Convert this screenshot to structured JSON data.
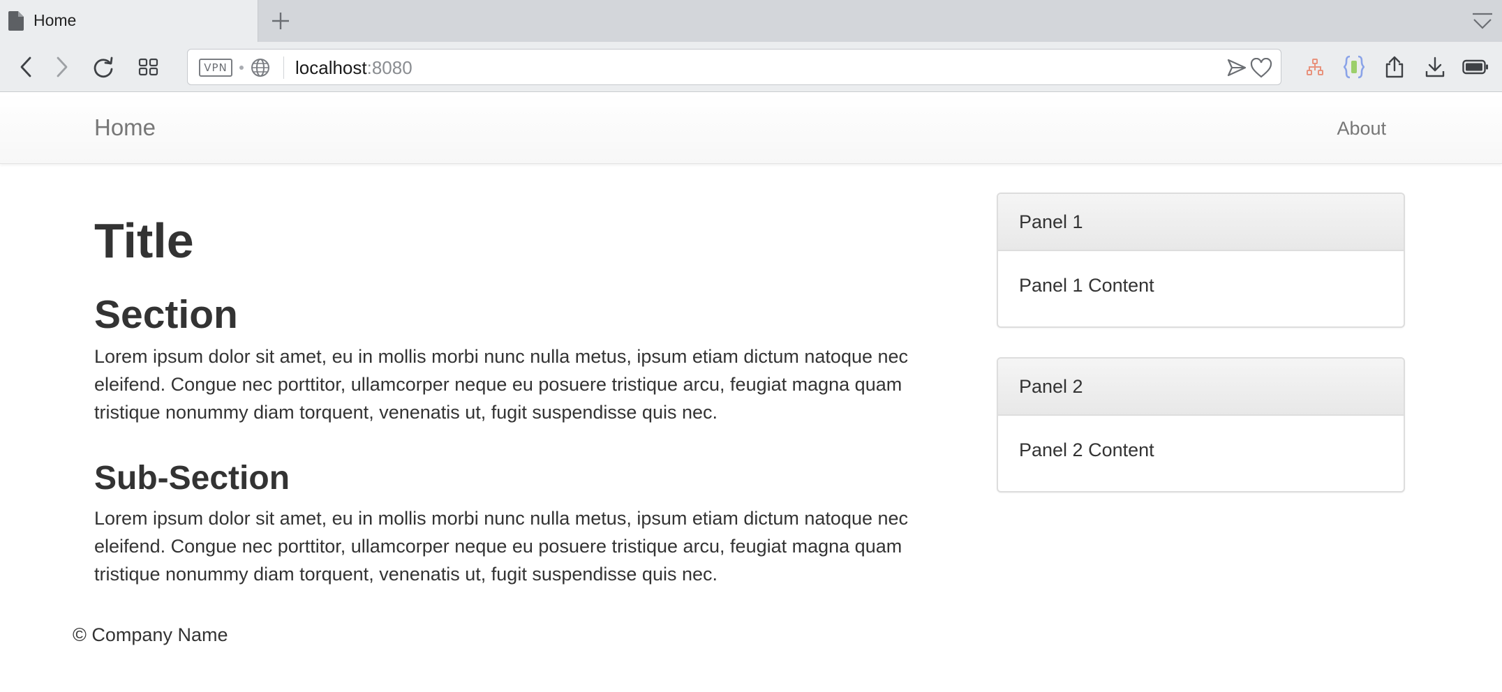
{
  "browser": {
    "tab": {
      "title": "Home",
      "icon": "document-icon"
    },
    "new_tab_icon": "plus-icon",
    "tab_menu_icon": "tab-menu-icon",
    "toolbar": {
      "back_icon": "back-arrow-icon",
      "forward_icon": "forward-arrow-icon",
      "reload_icon": "reload-icon",
      "tabs_grid_icon": "grid-icon",
      "right_icons": [
        "sitemap-icon",
        "extension-icon",
        "share-icon",
        "download-icon",
        "battery-icon"
      ]
    },
    "urlbar": {
      "vpn_label": "VPN",
      "host": "localhost",
      "port": ":8080"
    }
  },
  "navbar": {
    "brand": "Home",
    "links": [
      "About"
    ]
  },
  "main": {
    "title": "Title",
    "section": "Section",
    "section_text": "Lorem ipsum dolor sit amet, eu in mollis morbi nunc nulla metus, ipsum etiam dictum natoque nec eleifend. Congue nec porttitor, ullamcorper neque eu posuere tristique arcu, feugiat magna quam tristique nonummy diam torquent, venenatis ut, fugit suspendisse quis nec.",
    "subsection": "Sub-Section",
    "subsection_text": "Lorem ipsum dolor sit amet, eu in mollis morbi nunc nulla metus, ipsum etiam dictum natoque nec eleifend. Congue nec porttitor, ullamcorper neque eu posuere tristique arcu, feugiat magna quam tristique nonummy diam torquent, venenatis ut, fugit suspendisse quis nec."
  },
  "panels": [
    {
      "heading": "Panel 1",
      "content": "Panel 1 Content"
    },
    {
      "heading": "Panel 2",
      "content": "Panel 2 Content"
    }
  ],
  "footer": "© Company Name",
  "colors": {
    "chrome_bg": "#ebedef",
    "tabstrip_bg": "#d3d6da",
    "nav_text": "#777777",
    "body_text": "#333333",
    "panel_border": "#dddddd",
    "sitemap_icon": "#e8927c",
    "extension_icon": "#8aa3e8"
  }
}
